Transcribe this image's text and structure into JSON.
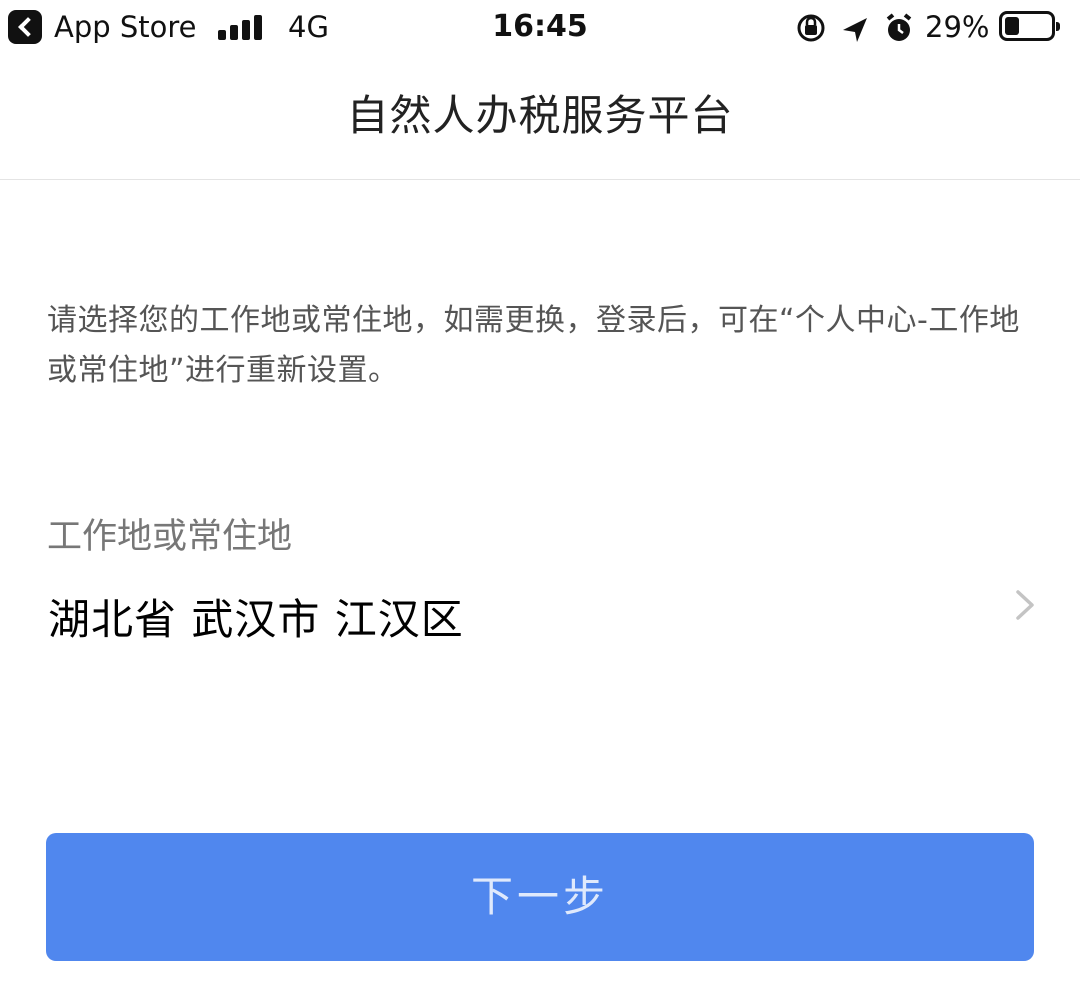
{
  "status_bar": {
    "back_app": "App Store",
    "network": "4G",
    "time": "16:45",
    "battery": "29%",
    "icons": [
      "back-arrow-icon",
      "signal-bars-icon",
      "rotation-lock-icon",
      "location-arrow-icon",
      "alarm-icon",
      "battery-icon"
    ]
  },
  "nav": {
    "title": "自然人办税服务平台"
  },
  "intro_text": "请选择您的工作地或常住地，如需更换，登录后，可在“个人中心-工作地或常住地”进行重新设置。",
  "field": {
    "label": "工作地或常住地",
    "value": "湖北省 武汉市 江汉区"
  },
  "button": {
    "label": "下一步"
  },
  "colors": {
    "primary": "#5087ee",
    "button_text": "#dfe9fc",
    "hint_text": "#555555",
    "label_text": "#777777"
  }
}
